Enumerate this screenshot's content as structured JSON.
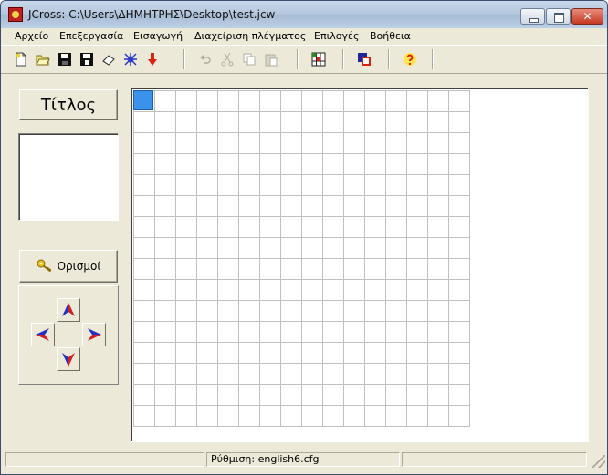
{
  "window": {
    "title": "JCross: C:\\Users\\ΔΗΜΗΤΡΗΣ\\Desktop\\test.jcw",
    "close_glyph": "✕"
  },
  "menu": {
    "items": [
      {
        "label": "Αρχείο"
      },
      {
        "label": "Επεξεργασία"
      },
      {
        "label": "Εισαγωγή"
      },
      {
        "label": "Διαχείριση πλέγματος"
      },
      {
        "label": "Επιλογές"
      },
      {
        "label": "Βοήθεια"
      }
    ]
  },
  "toolbar": {
    "icons": [
      "new-file-icon",
      "open-folder-icon",
      "save-icon",
      "save-as-icon",
      "eraser-icon",
      "web-export-icon",
      "download-arrow-icon",
      "undo-icon",
      "cut-icon",
      "copy-icon",
      "paste-icon",
      "grid-icon",
      "color-palette-icon",
      "help-icon"
    ]
  },
  "left_panel": {
    "title_button": "Τίτλος",
    "definitions_button": "Ορισμοί"
  },
  "grid": {
    "columns": 16,
    "rows": 16,
    "cursor_color": "#3a92ea"
  },
  "statusbar": {
    "config": "Ρύθμιση: english6.cfg"
  },
  "colors": {
    "window_bg": "#ece9d8",
    "arrow_blue": "#2030c8",
    "arrow_red": "#d02020"
  }
}
